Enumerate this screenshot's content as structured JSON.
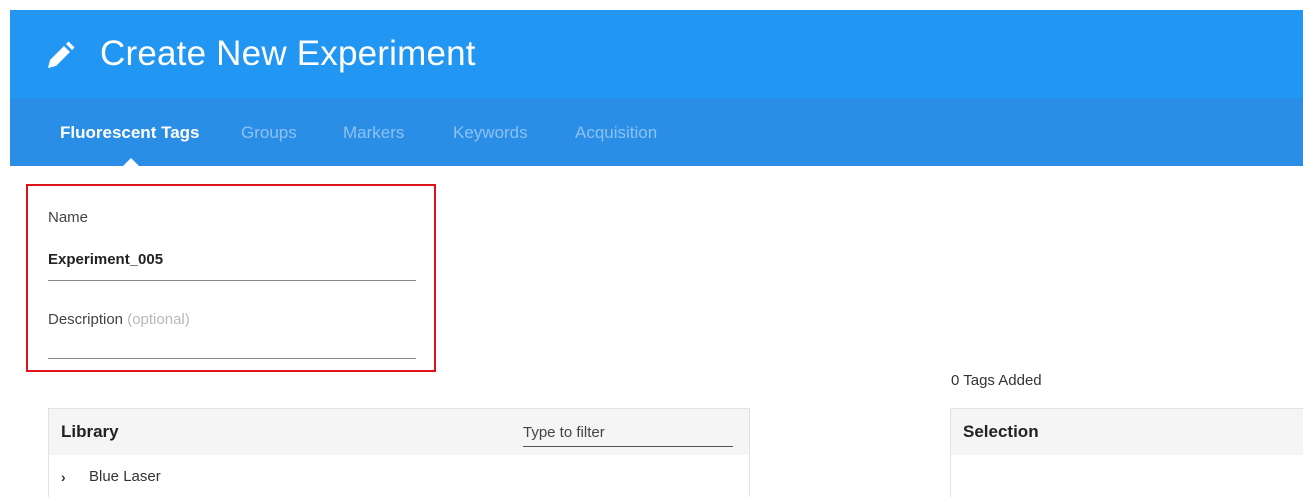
{
  "header": {
    "title": "Create New Experiment",
    "icon": "pencil-icon"
  },
  "tabs": [
    {
      "label": "Fluorescent Tags",
      "active": true
    },
    {
      "label": "Groups",
      "active": false
    },
    {
      "label": "Markers",
      "active": false
    },
    {
      "label": "Keywords",
      "active": false
    },
    {
      "label": "Acquisition",
      "active": false
    }
  ],
  "form": {
    "name_label": "Name",
    "name_value": "Experiment_005",
    "description_label": "Description",
    "description_optional": "(optional)",
    "description_value": ""
  },
  "tags_added": "0 Tags Added",
  "library": {
    "title": "Library",
    "filter_placeholder": "Type to filter",
    "items": [
      {
        "label": "Blue Laser",
        "icon": "chevron-right-icon"
      }
    ]
  },
  "selection": {
    "title": "Selection"
  },
  "colors": {
    "header": "#2196f3",
    "tabbar": "#2b8ee6",
    "highlight": "#e0131a"
  }
}
